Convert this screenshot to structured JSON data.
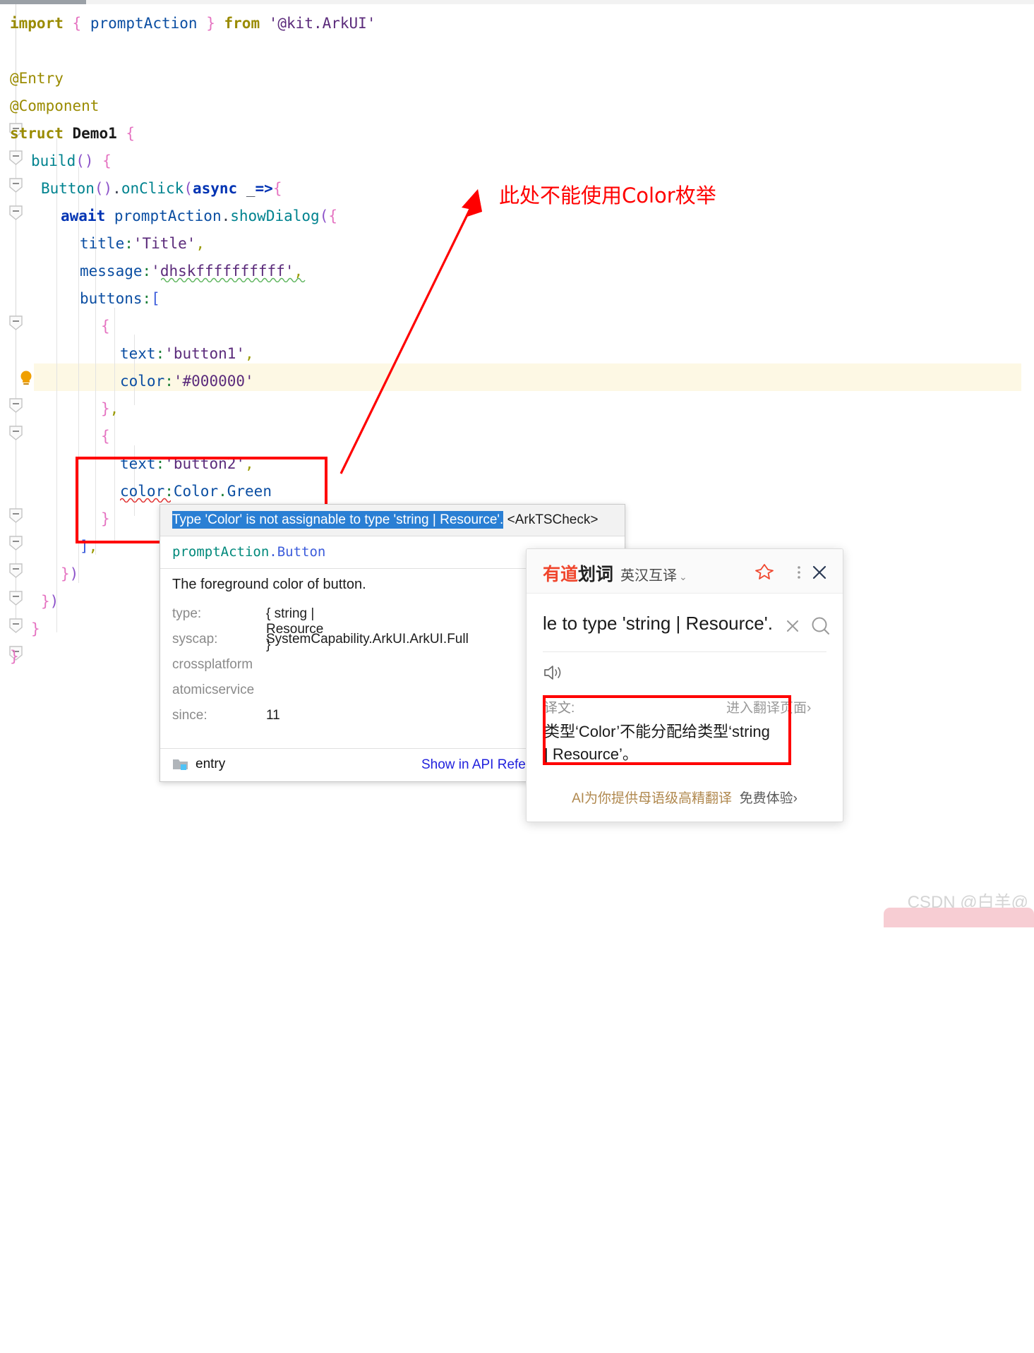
{
  "editor": {
    "language": "ArkTS",
    "code_lines": [
      "import { promptAction } from '@kit.ArkUI'",
      "",
      "@Entry",
      "@Component",
      "struct Demo1 {",
      "  build() {",
      "   Button().onClick(async _=>{",
      "     await promptAction.showDialog({",
      "       title:'Title',",
      "       message:'dhskffffffffff',",
      "       buttons:[",
      "         {",
      "           text:'button1',",
      "           color:'#000000'",
      "         },",
      "         {",
      "           text:'button2',",
      "           color:Color.Green",
      "         }",
      "       ],",
      "     })",
      "   })",
      "  }",
      "}"
    ],
    "tokens": {
      "import": "import",
      "from": "from",
      "module_path": "'@kit.ArkUI'",
      "promptAction": "promptAction",
      "entry_decorator": "@Entry",
      "component_decorator": "@Component",
      "struct": "struct",
      "struct_name": "Demo1",
      "build": "build",
      "button": "Button",
      "onClick": "onClick",
      "async": "async",
      "arrow_param": "_=>",
      "await": "await",
      "showDialog": "showDialog",
      "title_key": "title",
      "title_value": "'Title'",
      "message_key": "message",
      "message_value": "'dhskffffffffff'",
      "buttons_key": "buttons",
      "text_key": "text",
      "button1_value": "'button1'",
      "color_key": "color",
      "black_value": "'#000000'",
      "button2_value": "'button2'",
      "color_enum": "Color.Green"
    },
    "highlighted_line_index": 13,
    "gutter": {
      "bulb_icon": "lightbulb-icon",
      "fold_icon": "fold-minus-icon"
    }
  },
  "annotation": {
    "text": "此处不能使用Color枚举",
    "color": "#ff0000",
    "arrow": "red-arrow-pointing-to-code"
  },
  "tooltip": {
    "error_message": "Type 'Color' is not assignable to type 'string | Resource'.",
    "inspection_tag": "<ArkTSCheck>",
    "signature": "promptAction.Button",
    "signature_left": "promptAction",
    "signature_dot": ".",
    "signature_right": "Button",
    "description": "The foreground color of button.",
    "rows": [
      {
        "key": "type:",
        "value": "{ string | Resource }"
      },
      {
        "key": "syscap:",
        "value": "SystemCapability.ArkUI.ArkUI.Full"
      },
      {
        "key": "crossplatform",
        "value": ""
      },
      {
        "key": "atomicservice",
        "value": ""
      },
      {
        "key": "since:",
        "value": "11"
      }
    ],
    "footer_module": "entry",
    "footer_link": "Show in API Refe",
    "footer_link_full": "Show in API Reference"
  },
  "youdao": {
    "logo_red": "有道",
    "logo_black": "划词",
    "language_mode": "英汉互译",
    "chevron": "⌄",
    "icons": {
      "pin": "pin-icon",
      "more": "more-vertical-icon",
      "close": "close-icon",
      "clear": "clear-icon",
      "search": "search-icon",
      "speaker": "speaker-icon"
    },
    "query_text": "le to type 'string | Resource'.",
    "translation_label": "译文:",
    "translation_link": "进入翻译页面",
    "translation_link_arrow": "›",
    "translation_body": "类型‘Color’不能分配给类型‘string | Resource’。",
    "promo_text": "AI为你提供母语级高精翻译",
    "promo_cta": "免费体验",
    "promo_cta_arrow": "›"
  },
  "watermark": {
    "text": "CSDN @白羊@"
  },
  "colors": {
    "annotation_red": "#ff0000",
    "selection_blue": "#2a7fd4",
    "link_blue": "#2222dd",
    "highlight_row": "#fdf8e4",
    "youdao_red": "#f0462d"
  }
}
